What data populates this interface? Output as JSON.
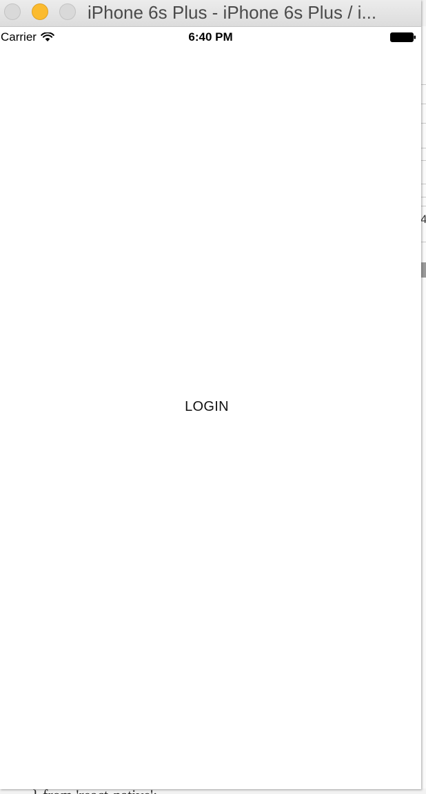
{
  "window": {
    "title": "iPhone 6s Plus - iPhone 6s Plus / i..."
  },
  "status_bar": {
    "carrier": "Carrier",
    "time": "6:40 PM",
    "icons": [
      "wifi-icon",
      "battery-icon"
    ]
  },
  "app": {
    "login_label": "LOGIN"
  },
  "background": {
    "code_text": "} from 'react-native';",
    "edge_glyph": "4"
  },
  "colors": {
    "minimize_button": "#fbbb2f",
    "inactive_button": "#d9d9d9",
    "titlebar": "#e4e4e4",
    "screen_background": "#ffffff"
  }
}
